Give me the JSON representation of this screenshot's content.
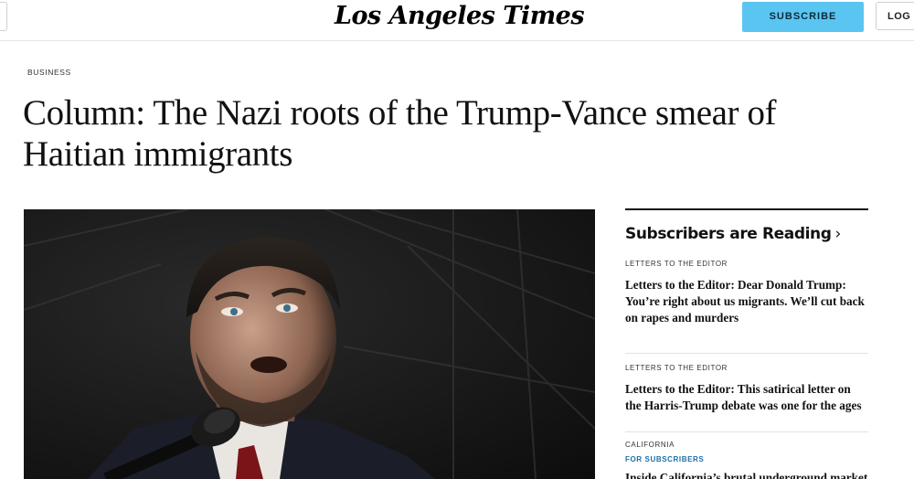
{
  "header": {
    "logo_text": "Los Angeles Times",
    "subscribe_label": "SUBSCRIBE",
    "login_label": "LOG IN"
  },
  "article": {
    "section": "BUSINESS",
    "headline": "Column: The Nazi roots of the Trump-Vance smear of Haitian immigrants"
  },
  "sidebar": {
    "heading": "Subscribers are Reading",
    "heading_icon": "chevron-right-icon",
    "stories": [
      {
        "kicker": "LETTERS TO THE EDITOR",
        "title": "Letters to the Editor: Dear Donald Trump: You’re right about us migrants. We’ll cut back on rapes and murders"
      },
      {
        "kicker": "LETTERS TO THE EDITOR",
        "title": "Letters to the Editor: This satirical letter on the Harris-Trump debate was one for the ages"
      },
      {
        "kicker": "CALIFORNIA",
        "badge": "FOR SUBSCRIBERS",
        "title": "Inside California’s brutal underground market"
      }
    ]
  },
  "colors": {
    "subscribe_button": "#5bc5f2",
    "subscriber_badge": "#1a6fa8"
  }
}
